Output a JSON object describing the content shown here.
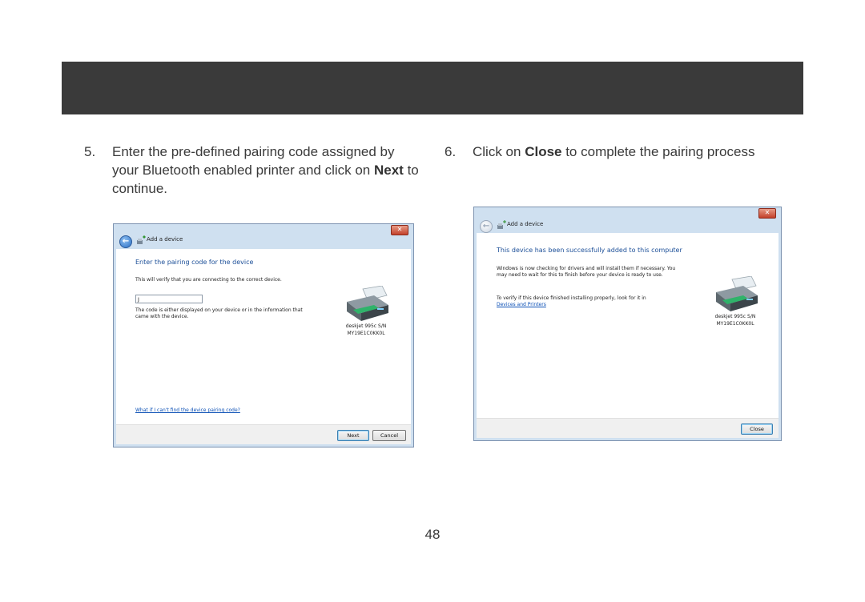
{
  "steps": [
    {
      "number": "5.",
      "before": "Enter the pre-defined pairing code assigned by your Bluetooth enabled printer and click on ",
      "bold": "Next",
      "after": " to continue."
    },
    {
      "number": "6.",
      "before": "Click on ",
      "bold": "Close",
      "after": " to complete the pairing process"
    }
  ],
  "dialog1": {
    "close_glyph": "✕",
    "back_glyph": "←",
    "title": "Add a device",
    "heading": "Enter the pairing code for the device",
    "subtext": "This will verify that you are connecting to the correct device.",
    "code_value": "J",
    "info": "The code is either displayed on your device or in the information that came with the device.",
    "printer_name": "deskjet 995c S/N",
    "printer_serial": "MY19E1C0KK0L",
    "help_link": "What if I can't find the device pairing code?",
    "next_label": "Next",
    "cancel_label": "Cancel"
  },
  "dialog2": {
    "close_glyph": "✕",
    "back_glyph": "←",
    "title": "Add a device",
    "heading": "This device has been successfully added to this computer",
    "status": "Windows is now checking for drivers and will install them if necessary. You may need to wait for this to finish before your device is ready to use.",
    "verify": "To verify if this device finished installing properly, look for it in",
    "devices_link": "Devices and Printers",
    "printer_name": "deskjet 995c S/N",
    "printer_serial": "MY19E1C0KK0L",
    "close_label": "Close"
  },
  "page_number": "48",
  "colors": {
    "banner": "#3a3a3a",
    "dialog_heading": "#1c4f98",
    "link": "#0a4fb5"
  }
}
